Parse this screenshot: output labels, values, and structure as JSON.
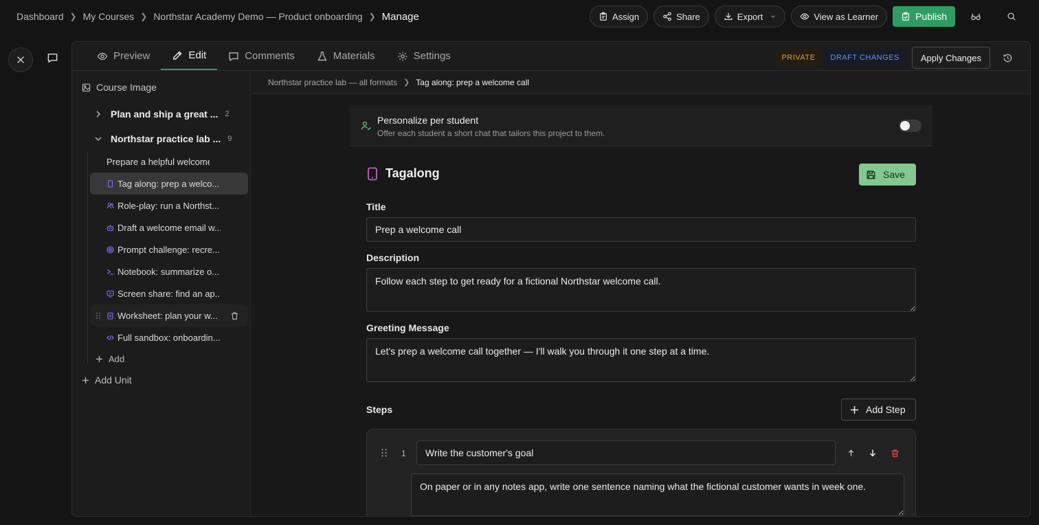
{
  "breadcrumb": {
    "items": [
      "Dashboard",
      "My Courses",
      "Northstar Academy Demo — Product onboarding"
    ],
    "current": "Manage"
  },
  "top_actions": {
    "assign": "Assign",
    "share": "Share",
    "export": "Export",
    "view_as_learner": "View as Learner",
    "publish": "Publish"
  },
  "tabs": [
    {
      "label": "Preview",
      "icon": "eye-icon"
    },
    {
      "label": "Edit",
      "icon": "pencil-icon"
    },
    {
      "label": "Comments",
      "icon": "comment-icon"
    },
    {
      "label": "Materials",
      "icon": "flask-icon"
    },
    {
      "label": "Settings",
      "icon": "gear-icon"
    }
  ],
  "status": {
    "private": "PRIVATE",
    "draft": "DRAFT CHANGES",
    "apply": "Apply Changes"
  },
  "tree": {
    "course_image": "Course Image",
    "units": [
      {
        "title": "Plan and ship a great ...",
        "count": "2"
      },
      {
        "title": "Northstar practice lab ...",
        "count": "9"
      }
    ],
    "items": [
      {
        "label": "Prepare a helpful welcome ...",
        "icon": "none"
      },
      {
        "label": "Tag along: prep a welco...",
        "icon": "phone-icon"
      },
      {
        "label": "Role-play: run a Northst...",
        "icon": "people-icon"
      },
      {
        "label": "Draft a welcome email w...",
        "icon": "robot-icon"
      },
      {
        "label": "Prompt challenge: recre...",
        "icon": "target-icon"
      },
      {
        "label": "Notebook: summarize o...",
        "icon": "terminal-icon"
      },
      {
        "label": "Screen share: find an ap...",
        "icon": "monitor-icon"
      },
      {
        "label": "Worksheet: plan your w...",
        "icon": "clipboard-icon"
      },
      {
        "label": "Full sandbox: onboardin...",
        "icon": "code-icon"
      }
    ],
    "add": "Add",
    "add_unit": "Add Unit"
  },
  "content_crumb": {
    "parent": "Northstar practice lab — all formats",
    "current": "Tag along: prep a welcome call"
  },
  "personalize": {
    "title": "Personalize per student",
    "subtitle": "Offer each student a short chat that tailors this project to them.",
    "enabled": false
  },
  "block": {
    "type": "Tagalong",
    "save": "Save",
    "title_label": "Title",
    "title_value": "Prep a welcome call",
    "description_label": "Description",
    "description_value": "Follow each step to get ready for a fictional Northstar welcome call.",
    "greeting_label": "Greeting Message",
    "greeting_value": "Let's prep a welcome call together — I'll walk you through it one step at a time.",
    "steps_label": "Steps",
    "add_step": "Add Step",
    "steps": [
      {
        "number": "1",
        "title": "Write the customer's goal",
        "description": "On paper or in any notes app, write one sentence naming what the fictional customer wants in week one."
      }
    ]
  },
  "colors": {
    "accent_green": "#2f9d63",
    "save_green": "#83c98f",
    "private": "#e0a030",
    "draft": "#6b8fe8",
    "delete_red": "#e04848",
    "item_icon_purple": "#8b6cf0"
  }
}
